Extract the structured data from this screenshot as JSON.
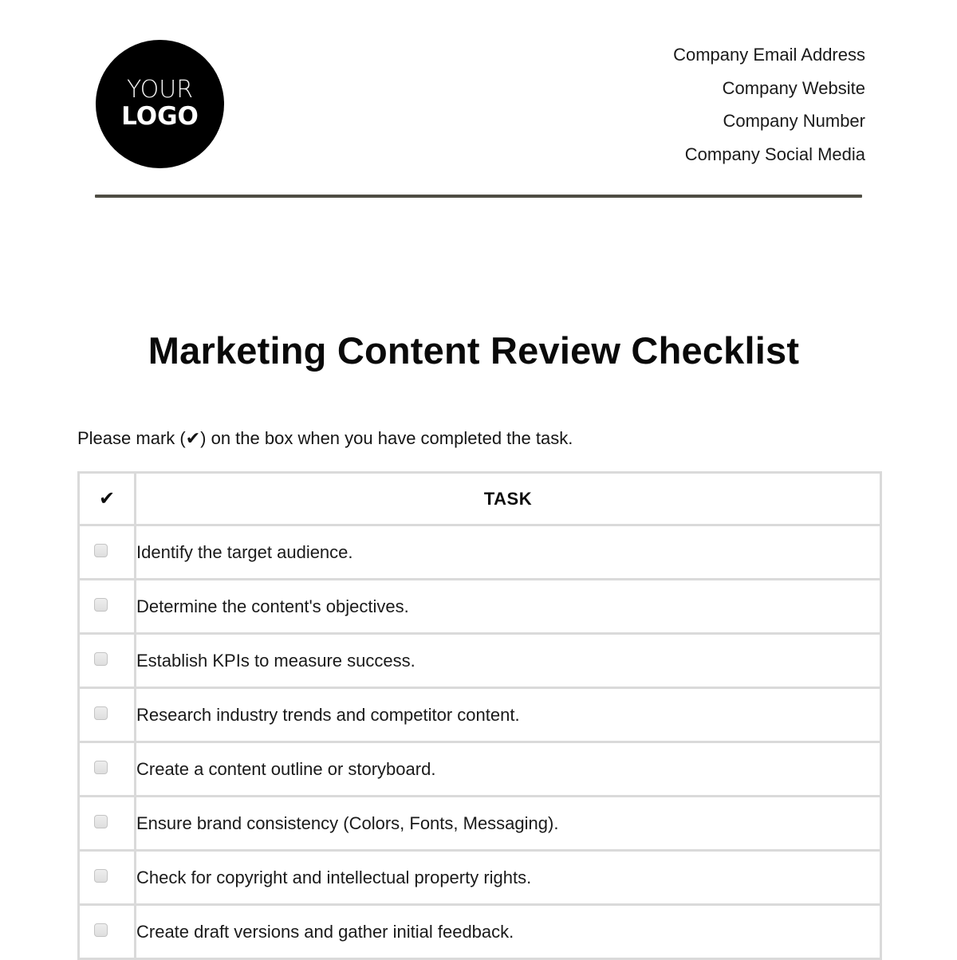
{
  "header": {
    "logo": {
      "line1": "YOUR",
      "line2": "LOGO"
    },
    "contact": [
      "Company Email Address",
      "Company Website",
      "Company Number",
      "Company Social Media"
    ]
  },
  "document": {
    "title": "Marketing Content Review Checklist",
    "instruction": "Please mark (✔) on the box when you have completed the task."
  },
  "table": {
    "headers": {
      "check": "✔",
      "task": "TASK"
    },
    "rows": [
      {
        "task": "Identify the target audience.",
        "checked": false
      },
      {
        "task": "Determine the content's objectives.",
        "checked": false
      },
      {
        "task": "Establish KPIs to measure success.",
        "checked": false
      },
      {
        "task": "Research industry trends and competitor content.",
        "checked": false
      },
      {
        "task": "Create a content outline or storyboard.",
        "checked": false
      },
      {
        "task": "Ensure brand consistency (Colors, Fonts, Messaging).",
        "checked": false
      },
      {
        "task": "Check for copyright and intellectual property rights.",
        "checked": false
      },
      {
        "task": "Create draft versions and gather initial feedback.",
        "checked": false
      }
    ]
  },
  "colors": {
    "divider": "#4e4d43",
    "table_border": "#dadada",
    "logo_background": "#000000"
  }
}
